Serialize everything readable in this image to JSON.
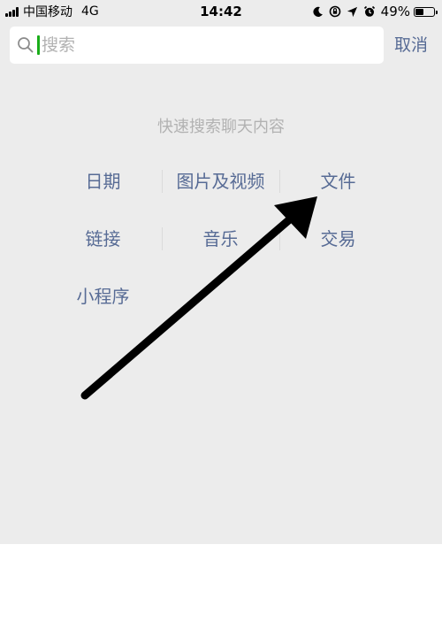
{
  "status_bar": {
    "carrier": "中国移动",
    "network": "4G",
    "time": "14:42",
    "battery_percent": "49%",
    "battery_level": 0.49,
    "icons": [
      "moon-icon",
      "rotation-lock-icon",
      "location-icon",
      "alarm-icon",
      "battery-icon"
    ]
  },
  "search": {
    "placeholder": "搜索",
    "value": "",
    "cancel_label": "取消"
  },
  "quick_search": {
    "title": "快速搜索聊天内容",
    "items": [
      {
        "label": "日期"
      },
      {
        "label": "图片及视频"
      },
      {
        "label": "文件"
      },
      {
        "label": "链接"
      },
      {
        "label": "音乐"
      },
      {
        "label": "交易"
      },
      {
        "label": "小程序"
      }
    ]
  },
  "colors": {
    "background": "#ececec",
    "link": "#576b95",
    "hint": "#b2b2b2",
    "caret": "#1aad19",
    "annotation_arrow": "#000000"
  }
}
